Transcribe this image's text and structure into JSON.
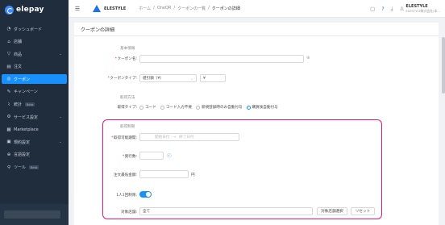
{
  "sidebar": {
    "brand": "elepay",
    "items": [
      {
        "label": "ダッシュボード",
        "icon": "dashboard-icon",
        "glyph": "◔",
        "active": false,
        "chevron": false,
        "beta": ""
      },
      {
        "label": "店舗",
        "icon": "store-icon",
        "glyph": "⌂",
        "active": false,
        "chevron": false,
        "beta": ""
      },
      {
        "label": "商品",
        "icon": "product-icon",
        "glyph": "▽",
        "active": false,
        "chevron": true,
        "beta": ""
      },
      {
        "label": "注文",
        "icon": "order-icon",
        "glyph": "▤",
        "active": false,
        "chevron": false,
        "beta": ""
      },
      {
        "label": "クーポン",
        "icon": "coupon-icon",
        "glyph": "◎",
        "active": true,
        "chevron": false,
        "beta": ""
      },
      {
        "label": "キャンペーン",
        "icon": "campaign-icon",
        "glyph": "✎",
        "active": false,
        "chevron": false,
        "beta": ""
      },
      {
        "label": "統計",
        "icon": "stats-icon",
        "glyph": "⌇",
        "active": false,
        "chevron": false,
        "beta": "Beta"
      },
      {
        "label": "サービス設定",
        "icon": "service-settings-icon",
        "glyph": "⚙",
        "active": false,
        "chevron": true,
        "beta": ""
      },
      {
        "label": "Marketplace",
        "icon": "marketplace-icon",
        "glyph": "▦",
        "active": false,
        "chevron": false,
        "beta": ""
      },
      {
        "label": "規約設定",
        "icon": "terms-icon",
        "glyph": "▣",
        "active": false,
        "chevron": true,
        "beta": ""
      },
      {
        "label": "言語設定",
        "icon": "language-icon",
        "glyph": "⊕",
        "active": false,
        "chevron": false,
        "beta": ""
      },
      {
        "label": "ツール",
        "icon": "tool-icon",
        "glyph": "⚲",
        "active": false,
        "chevron": false,
        "beta": "Beta"
      }
    ]
  },
  "topbar": {
    "menu_icon": "☰",
    "store_name": "ELESTYLE",
    "breadcrumb": [
      "ホーム",
      "/",
      "OneQR",
      "/",
      "クーポンの一覧",
      "/",
      "クーポンの詳細"
    ],
    "user_name": "ELESTYLE",
    "user_sub": "ELESTYLE株式会社(本..."
  },
  "page": {
    "title": "クーポンの詳細",
    "basic_section": "基本情報",
    "coupon_name_label": "クーポン名:",
    "coupon_name_value": "",
    "coupon_type_label": "クーポンタイプ:",
    "coupon_type_value": "値引額（¥）",
    "currency_prefix": "¥",
    "amount_value": "",
    "acquisition_section": "取得方法",
    "acquisition_type_label": "取得タイプ:",
    "acquisition_options": [
      {
        "label": "コード",
        "selected": false
      },
      {
        "label": "コード入力不要",
        "selected": false
      },
      {
        "label": "新規登録時のみ自動付与",
        "selected": false
      },
      {
        "label": "購買後自動付与",
        "selected": true
      }
    ],
    "restriction_section": "取得制限",
    "period_label": "取得可能期間:",
    "period_start_placeholder": "開始日付",
    "period_sep": "→",
    "period_end_placeholder": "終了日付",
    "issue_count_label": "発行数:",
    "issue_count_value": "",
    "min_amount_label": "注文最低金額:",
    "min_amount_value": "",
    "min_amount_unit": "円",
    "one_per_person_label": "1人1回制限:",
    "one_per_person_on": true,
    "target_store_label": "対象店舗:",
    "target_store_value": "全て",
    "select_store_button": "対象店舗選択",
    "reset_button": "リセット"
  },
  "colors": {
    "sidebar_bg": "#1f2d3d",
    "accent": "#1890ff",
    "highlight": "#e51b73"
  }
}
